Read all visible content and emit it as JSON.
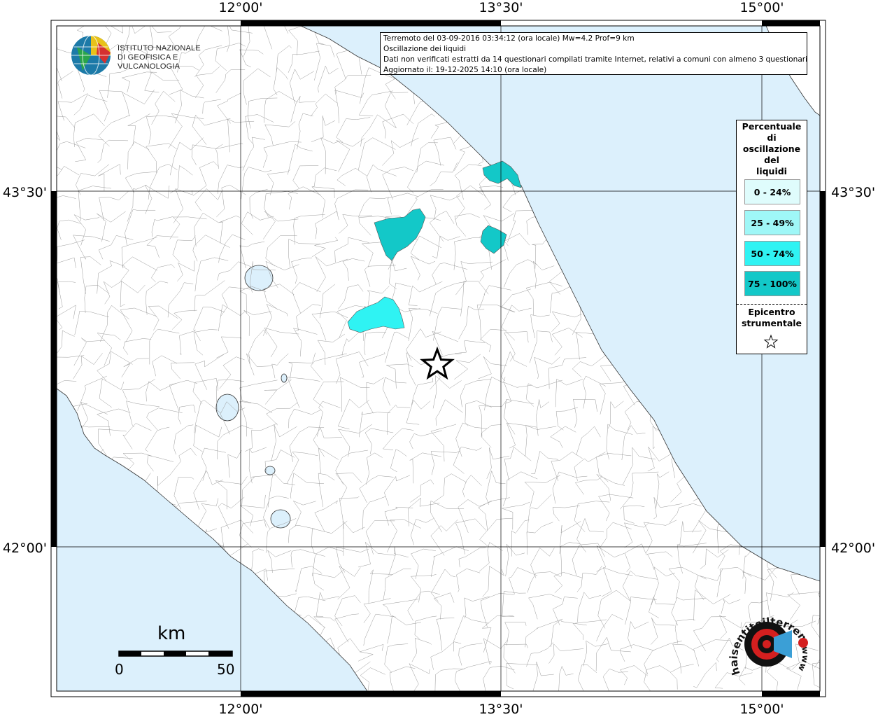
{
  "axes": {
    "x_labels": [
      "12°00'",
      "13°30'",
      "15°00'"
    ],
    "y_labels": [
      "43°30'",
      "42°00'"
    ]
  },
  "logo": {
    "line1": "ISTITUTO NAZIONALE",
    "line2": "DI GEOFISICA E VULCANOLOGIA"
  },
  "info": {
    "line1": "Terremoto del 03-09-2016 03:34:12 (ora locale) Mw=4.2 Prof=9 km",
    "line2": "Oscillazione dei liquidi",
    "line3": "Dati non verificati estratti da 14 questionari compilati tramite Internet, relativi a comuni con almeno 3 questionari.",
    "line4": "Aggiornato il: 19-12-2025 14:10 (ora locale)"
  },
  "legend": {
    "title": [
      "Percentuale",
      "di",
      "oscillazione",
      "del",
      "liquidi"
    ],
    "classes": [
      {
        "label": "0 - 24%",
        "color": "#dffcfc"
      },
      {
        "label": "25 - 49%",
        "color": "#9ff7f7"
      },
      {
        "label": "50 - 74%",
        "color": "#2ff3f3"
      },
      {
        "label": "75 - 100%",
        "color": "#13c8c8"
      }
    ],
    "epicenter_title": [
      "Epicentro",
      "strumentale"
    ]
  },
  "scale": {
    "unit": "km",
    "min": "0",
    "max": "50"
  },
  "site_logo": {
    "text": "haisentitoilterremoto.it",
    "url_text": "www"
  },
  "colors": {
    "sea": "#dcf0fc",
    "land": "#ffffff",
    "class_50_74": "#2ff3f3",
    "class_75_100": "#13c8c8"
  }
}
